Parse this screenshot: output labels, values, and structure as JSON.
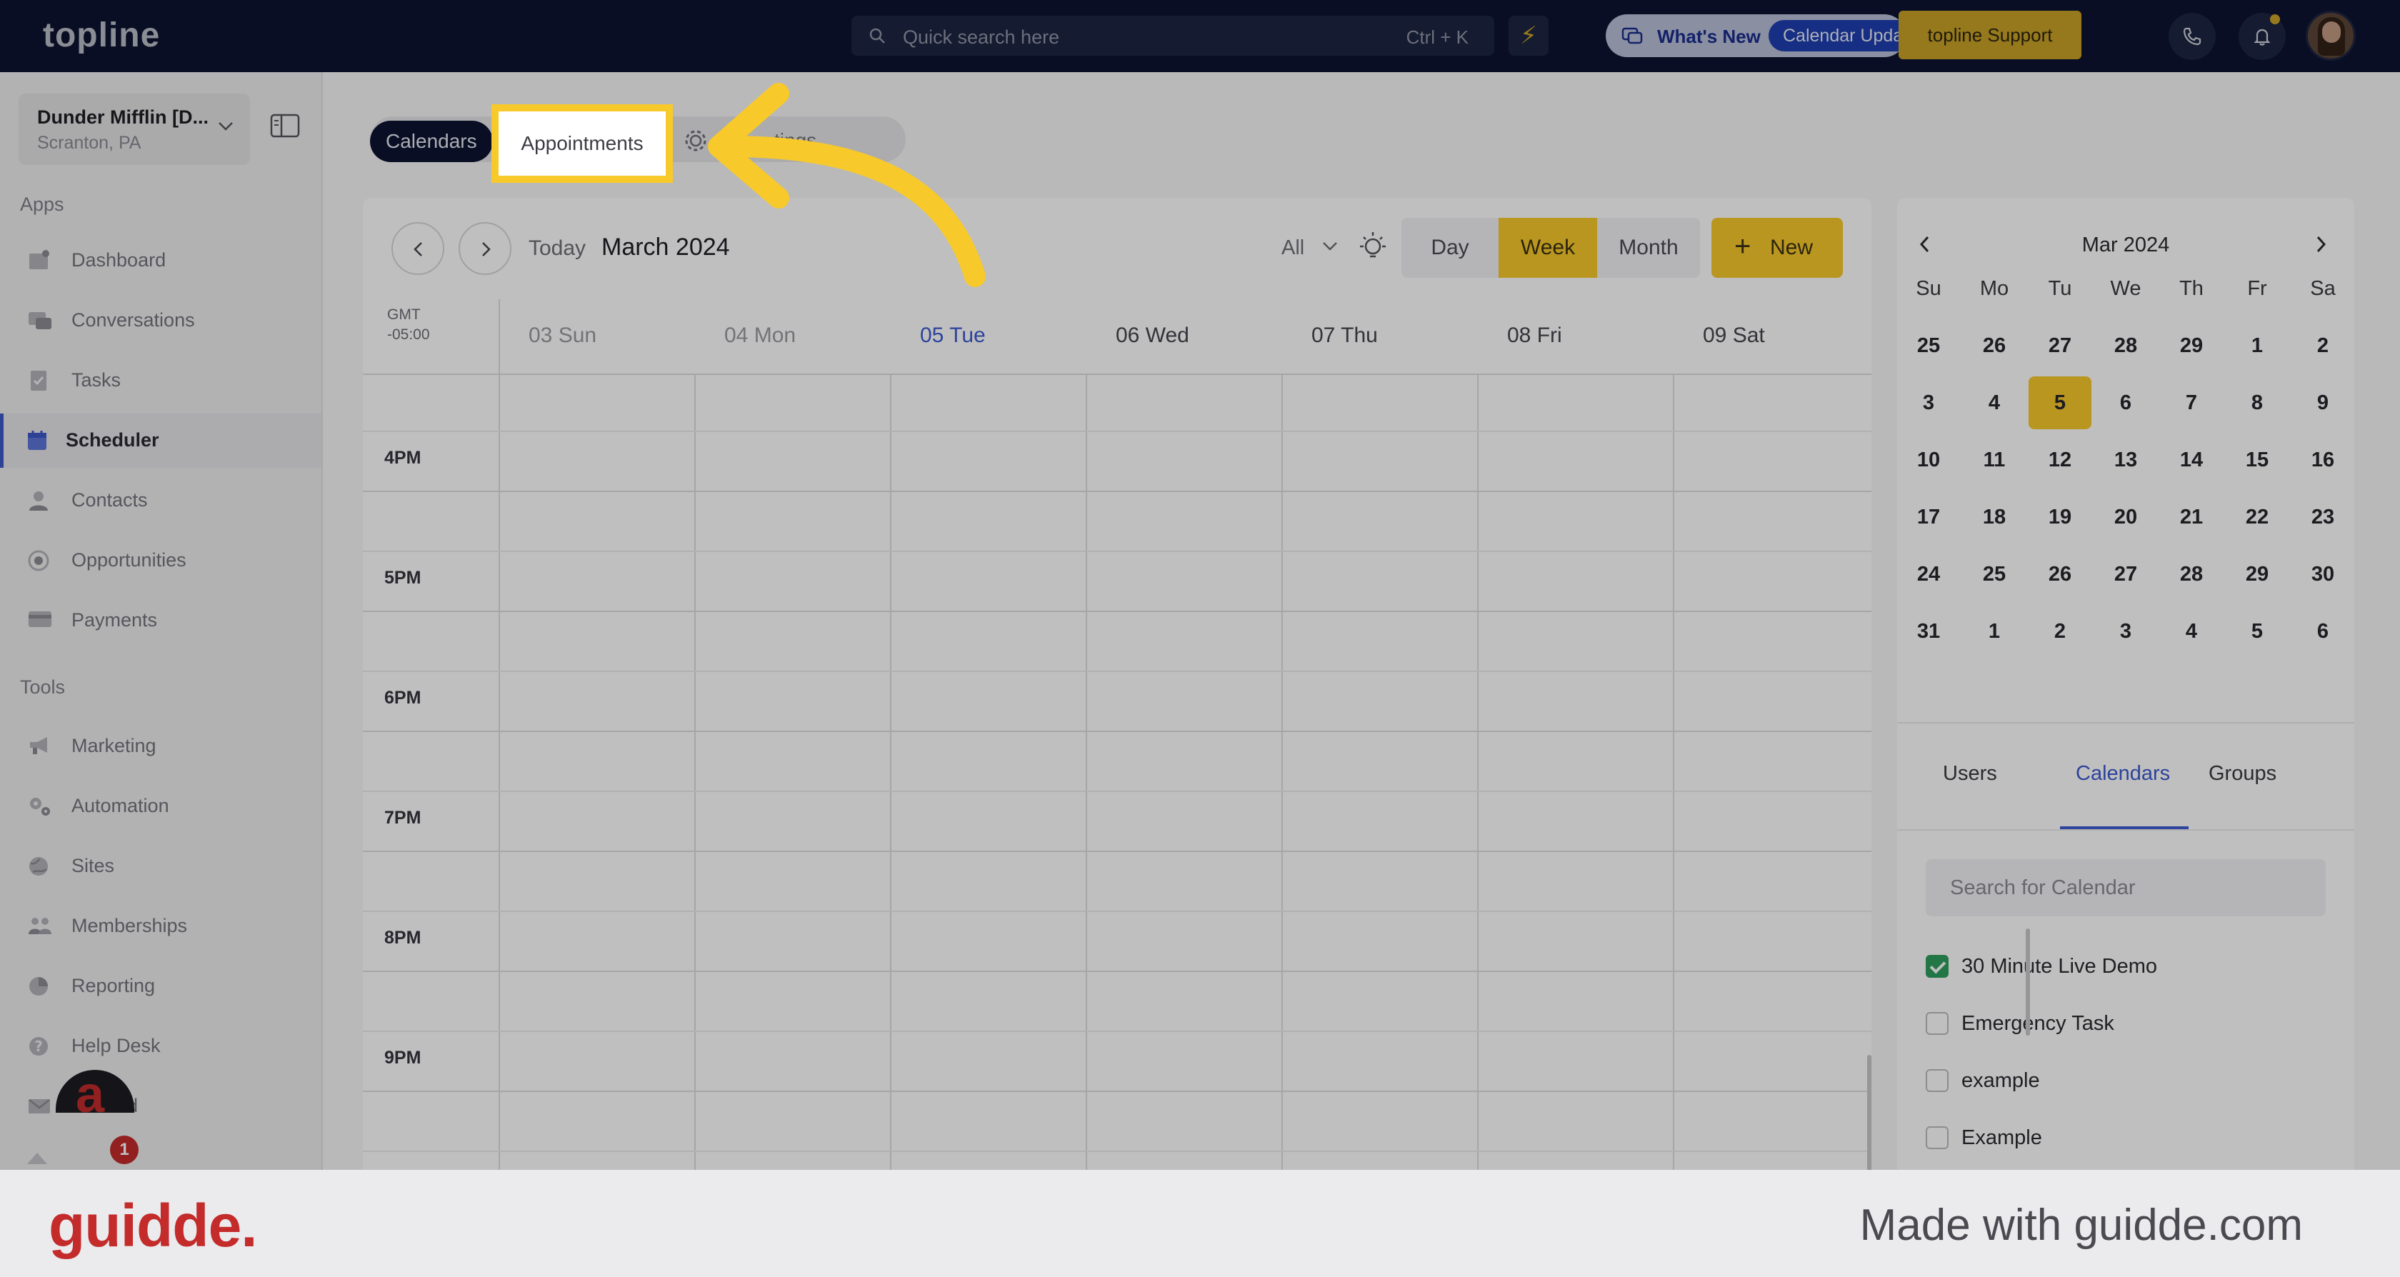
{
  "topbar": {
    "logo": "topline",
    "search_placeholder": "Quick search here",
    "search_shortcut": "Ctrl + K",
    "whats_new_label": "What's New",
    "whats_new_pill": "Calendar Upda",
    "support_label": "topline Support"
  },
  "sidebar": {
    "location_name": "Dunder Mifflin [D...",
    "location_sub": "Scranton, PA",
    "apps_title": "Apps",
    "tools_title": "Tools",
    "apps": [
      {
        "label": "Dashboard",
        "icon": "dashboard-icon"
      },
      {
        "label": "Conversations",
        "icon": "chat-icon"
      },
      {
        "label": "Tasks",
        "icon": "tasks-icon"
      },
      {
        "label": "Scheduler",
        "icon": "calendar-icon",
        "active": true
      },
      {
        "label": "Contacts",
        "icon": "person-icon"
      },
      {
        "label": "Opportunities",
        "icon": "target-icon"
      },
      {
        "label": "Payments",
        "icon": "card-icon"
      }
    ],
    "tools": [
      {
        "label": "Marketing",
        "icon": "megaphone-icon"
      },
      {
        "label": "Automation",
        "icon": "gears-icon"
      },
      {
        "label": "Sites",
        "icon": "globe-icon"
      },
      {
        "label": "Memberships",
        "icon": "users-icon"
      },
      {
        "label": "Reporting",
        "icon": "pie-chart-icon"
      },
      {
        "label": "Help Desk",
        "icon": "help-icon"
      },
      {
        "label": "Mailfold",
        "icon": "mail-icon"
      }
    ],
    "chat_badge": "1"
  },
  "main": {
    "tabs": {
      "calendars": "Calendars",
      "appointments": "Appointments",
      "settings_partial": "tings"
    },
    "toolbar": {
      "today": "Today",
      "month_title": "March 2024",
      "filter": "All",
      "views": [
        "Day",
        "Week",
        "Month"
      ],
      "selected_view": "Week",
      "new_label": "New"
    },
    "timezone": {
      "line1": "GMT",
      "line2": "-05:00"
    },
    "days": [
      "03 Sun",
      "04 Mon",
      "05 Tue",
      "06 Wed",
      "07 Thu",
      "08 Fri",
      "09 Sat"
    ],
    "today_day": "05 Tue",
    "hours": [
      "4PM",
      "5PM",
      "6PM",
      "7PM",
      "8PM",
      "9PM"
    ]
  },
  "mini_calendar": {
    "title": "Mar 2024",
    "weekdays": [
      "Su",
      "Mo",
      "Tu",
      "We",
      "Th",
      "Fr",
      "Sa"
    ],
    "weeks": [
      [
        "25",
        "26",
        "27",
        "28",
        "29",
        "1",
        "2"
      ],
      [
        "3",
        "4",
        "5",
        "6",
        "7",
        "8",
        "9"
      ],
      [
        "10",
        "11",
        "12",
        "13",
        "14",
        "15",
        "16"
      ],
      [
        "17",
        "18",
        "19",
        "20",
        "21",
        "22",
        "23"
      ],
      [
        "24",
        "25",
        "26",
        "27",
        "28",
        "29",
        "30"
      ],
      [
        "31",
        "1",
        "2",
        "3",
        "4",
        "5",
        "6"
      ]
    ],
    "selected": "5"
  },
  "right_panel": {
    "tabs": [
      "Users",
      "Calendars",
      "Groups"
    ],
    "selected_tab": "Calendars",
    "search_placeholder": "Search for Calendar",
    "calendars": [
      {
        "label": "30 Minute Live Demo",
        "checked": true
      },
      {
        "label": "Emergency Task",
        "checked": false
      },
      {
        "label": "example",
        "checked": false
      },
      {
        "label": "Example",
        "checked": false
      }
    ]
  },
  "footer": {
    "logo": "guidde.",
    "made_with": "Made with guidde.com"
  },
  "colors": {
    "topbar": "#0c1331",
    "accent_yellow": "#f7c92b",
    "brand_blue": "#3d5ad0",
    "guidde_red": "#c42b2b"
  }
}
